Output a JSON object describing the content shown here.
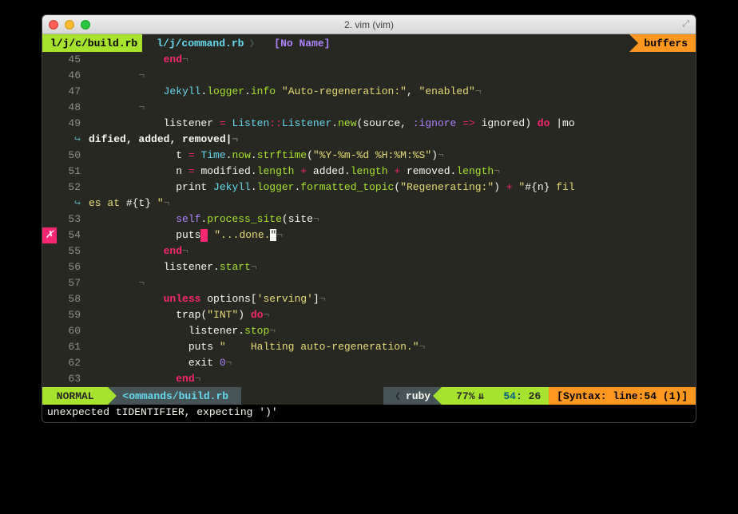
{
  "title": "2. vim (vim)",
  "tabs": {
    "active": "l/j/c/build.rb",
    "second": "l/j/command.rb",
    "third": "[No Name]"
  },
  "buffers_label": "buffers",
  "lines": [
    {
      "n": 45,
      "tokens": [
        [
          "            ",
          ""
        ],
        [
          "end",
          "kw"
        ],
        [
          "¬",
          "nl"
        ]
      ]
    },
    {
      "n": 46,
      "tokens": [
        [
          "        ¬",
          "nl"
        ]
      ]
    },
    {
      "n": 47,
      "tokens": [
        [
          "            ",
          ""
        ],
        [
          "Jekyll",
          "type"
        ],
        [
          ".",
          "punc"
        ],
        [
          "logger",
          "fn"
        ],
        [
          ".",
          "punc"
        ],
        [
          "info",
          "fn"
        ],
        [
          " ",
          ""
        ],
        [
          "\"Auto-regeneration:\"",
          "str"
        ],
        [
          ", ",
          "punc"
        ],
        [
          "\"enabled\"",
          "str"
        ],
        [
          "¬",
          "nl"
        ]
      ]
    },
    {
      "n": 48,
      "tokens": [
        [
          "        ¬",
          "nl"
        ]
      ]
    },
    {
      "n": 49,
      "tokens": [
        [
          "            ",
          ""
        ],
        [
          "listener ",
          "id"
        ],
        [
          "= ",
          "op"
        ],
        [
          "Listen",
          "type"
        ],
        [
          "::",
          "op"
        ],
        [
          "Listener",
          "type"
        ],
        [
          ".",
          "punc"
        ],
        [
          "new",
          "fn"
        ],
        [
          "(",
          "punc"
        ],
        [
          "source",
          "id"
        ],
        [
          ", ",
          "punc"
        ],
        [
          ":ignore",
          "sym"
        ],
        [
          " => ",
          "op"
        ],
        [
          "ignored",
          "id"
        ],
        [
          ") ",
          "punc"
        ],
        [
          "do",
          "kw"
        ],
        [
          " |",
          "bar"
        ],
        [
          "mo",
          "id"
        ]
      ]
    },
    {
      "wrap": true,
      "tokens": [
        [
          "dified",
          "id"
        ],
        [
          ", ",
          "punc"
        ],
        [
          "added",
          "id"
        ],
        [
          ", ",
          "punc"
        ],
        [
          "removed",
          "id"
        ],
        [
          "|",
          "bar"
        ],
        [
          "¬",
          "nl"
        ]
      ],
      "bold": true
    },
    {
      "n": 50,
      "tokens": [
        [
          "              ",
          ""
        ],
        [
          "t ",
          "id"
        ],
        [
          "= ",
          "op"
        ],
        [
          "Time",
          "type"
        ],
        [
          ".",
          "punc"
        ],
        [
          "now",
          "fn"
        ],
        [
          ".",
          "punc"
        ],
        [
          "strftime",
          "fn"
        ],
        [
          "(",
          "punc"
        ],
        [
          "\"%Y-%m-%d %H:%M:%S\"",
          "str"
        ],
        [
          ")",
          "punc"
        ],
        [
          "¬",
          "nl"
        ]
      ]
    },
    {
      "n": 51,
      "tokens": [
        [
          "              ",
          ""
        ],
        [
          "n ",
          "id"
        ],
        [
          "= ",
          "op"
        ],
        [
          "modified",
          "id"
        ],
        [
          ".",
          "punc"
        ],
        [
          "length",
          "fn"
        ],
        [
          " + ",
          "op"
        ],
        [
          "added",
          "id"
        ],
        [
          ".",
          "punc"
        ],
        [
          "length",
          "fn"
        ],
        [
          " + ",
          "op"
        ],
        [
          "removed",
          "id"
        ],
        [
          ".",
          "punc"
        ],
        [
          "length",
          "fn"
        ],
        [
          "¬",
          "nl"
        ]
      ]
    },
    {
      "n": 52,
      "tokens": [
        [
          "              ",
          ""
        ],
        [
          "print",
          "id"
        ],
        [
          " ",
          ""
        ],
        [
          "Jekyll",
          "type"
        ],
        [
          ".",
          "punc"
        ],
        [
          "logger",
          "fn"
        ],
        [
          ".",
          "punc"
        ],
        [
          "formatted_topic",
          "fn"
        ],
        [
          "(",
          "punc"
        ],
        [
          "\"Regenerating:\"",
          "str"
        ],
        [
          ")",
          "punc"
        ],
        [
          " + ",
          "op"
        ],
        [
          "\"",
          "str"
        ],
        [
          "#{",
          "interp"
        ],
        [
          "n",
          "id"
        ],
        [
          "}",
          "interp"
        ],
        [
          " fil",
          "str"
        ]
      ]
    },
    {
      "wrap": true,
      "tokens": [
        [
          "es at ",
          "str"
        ],
        [
          "#{",
          "interp"
        ],
        [
          "t",
          "id"
        ],
        [
          "}",
          "interp"
        ],
        [
          " \"",
          "str"
        ],
        [
          "¬",
          "nl"
        ]
      ]
    },
    {
      "n": 53,
      "tokens": [
        [
          "              ",
          ""
        ],
        [
          "self",
          "sym"
        ],
        [
          ".",
          "punc"
        ],
        [
          "process_site",
          "fn"
        ],
        [
          "(",
          "punc"
        ],
        [
          "site",
          "id"
        ],
        [
          "¬",
          "nl"
        ]
      ]
    },
    {
      "n": 54,
      "err": true,
      "tokens": [
        [
          "              ",
          ""
        ],
        [
          "puts",
          "id"
        ],
        [
          "█",
          "cursorblock"
        ],
        [
          " ",
          ""
        ],
        [
          "\"...done.",
          "str"
        ],
        [
          "\"",
          "cursor"
        ],
        [
          "¬",
          "nl"
        ]
      ]
    },
    {
      "n": 55,
      "tokens": [
        [
          "            ",
          ""
        ],
        [
          "end",
          "kw"
        ],
        [
          "¬",
          "nl"
        ]
      ]
    },
    {
      "n": 56,
      "tokens": [
        [
          "            ",
          ""
        ],
        [
          "listener",
          "id"
        ],
        [
          ".",
          "punc"
        ],
        [
          "start",
          "fn"
        ],
        [
          "¬",
          "nl"
        ]
      ]
    },
    {
      "n": 57,
      "tokens": [
        [
          "        ¬",
          "nl"
        ]
      ]
    },
    {
      "n": 58,
      "tokens": [
        [
          "            ",
          ""
        ],
        [
          "unless",
          "kw"
        ],
        [
          " ",
          ""
        ],
        [
          "options",
          "id"
        ],
        [
          "[",
          "punc"
        ],
        [
          "'serving'",
          "str"
        ],
        [
          "]",
          "punc"
        ],
        [
          "¬",
          "nl"
        ]
      ]
    },
    {
      "n": 59,
      "tokens": [
        [
          "              ",
          ""
        ],
        [
          "trap",
          "id"
        ],
        [
          "(",
          "punc"
        ],
        [
          "\"INT\"",
          "str"
        ],
        [
          ")",
          "punc"
        ],
        [
          " ",
          ""
        ],
        [
          "do",
          "kw"
        ],
        [
          "¬",
          "nl"
        ]
      ]
    },
    {
      "n": 60,
      "tokens": [
        [
          "                ",
          ""
        ],
        [
          "listener",
          "id"
        ],
        [
          ".",
          "punc"
        ],
        [
          "stop",
          "fn"
        ],
        [
          "¬",
          "nl"
        ]
      ]
    },
    {
      "n": 61,
      "tokens": [
        [
          "                ",
          ""
        ],
        [
          "puts",
          "id"
        ],
        [
          " ",
          ""
        ],
        [
          "\"    Halting auto-regeneration.\"",
          "str"
        ],
        [
          "¬",
          "nl"
        ]
      ]
    },
    {
      "n": 62,
      "tokens": [
        [
          "                ",
          ""
        ],
        [
          "exit",
          "id"
        ],
        [
          " ",
          ""
        ],
        [
          "0",
          "num"
        ],
        [
          "¬",
          "nl"
        ]
      ]
    },
    {
      "n": 63,
      "tokens": [
        [
          "              ",
          ""
        ],
        [
          "end",
          "kw"
        ],
        [
          "¬",
          "nl"
        ]
      ]
    }
  ],
  "status": {
    "mode": " NORMAL ",
    "file": "<ommands/build.rb",
    "filetype": "ruby",
    "percent": "77%",
    "line": "54",
    "col": "26",
    "syntax": "[Syntax: line:54 (1)]"
  },
  "cmdline": "unexpected tIDENTIFIER, expecting ')'"
}
